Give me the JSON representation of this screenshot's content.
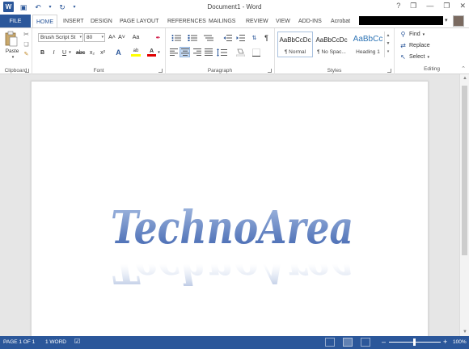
{
  "window": {
    "title": "Document1 - Word",
    "help": "?",
    "ribbon_options": "❐",
    "minimize": "—",
    "restore": "❐",
    "close": "✕"
  },
  "qat": {
    "word_logo": "W",
    "save": "▣",
    "undo": "↶",
    "undo_caret": "▾",
    "redo": "↻",
    "customize": "▾"
  },
  "tabs": {
    "file": "FILE",
    "home": "HOME",
    "insert": "INSERT",
    "design": "DESIGN",
    "page_layout": "PAGE LAYOUT",
    "references": "REFERENCES",
    "mailings": "MAILINGS",
    "review": "REVIEW",
    "view": "VIEW",
    "add_ins": "ADD-INS",
    "acrobat": "Acrobat"
  },
  "clipboard": {
    "paste": "Paste",
    "label": "Clipboard"
  },
  "font": {
    "name": "Brush Script St",
    "size": "80",
    "label": "Font",
    "grow": "A˄",
    "shrink": "A˅",
    "case": "Aa",
    "clear": "✒",
    "bold": "B",
    "italic": "I",
    "underline": "U",
    "strike": "abc",
    "subscript": "x₂",
    "superscript": "x²",
    "effects": "A",
    "highlight": "ab",
    "color": "A"
  },
  "paragraph": {
    "label": "Paragraph",
    "show_marks": "¶"
  },
  "styles": {
    "label": "Styles",
    "items": [
      {
        "sample": "AaBbCcDc",
        "name": "¶ Normal"
      },
      {
        "sample": "AaBbCcDc",
        "name": "¶ No Spac..."
      },
      {
        "sample": "AaBbCc",
        "name": "Heading 1"
      }
    ]
  },
  "editing": {
    "label": "Editing",
    "find": "Find",
    "replace": "Replace",
    "select": "Select",
    "caret": "▾"
  },
  "document": {
    "wordart_text": "TechnoArea"
  },
  "statusbar": {
    "page": "PAGE 1 OF 1",
    "words": "1 WORD",
    "zoom_minus": "–",
    "zoom_plus": "+",
    "zoom": "100%"
  },
  "colors": {
    "accent": "#2b579a",
    "wordart_light": "#a9bfe3",
    "wordart_dark": "#3a5fad",
    "highlight": "#ffff00",
    "font_color": "#e00000"
  }
}
